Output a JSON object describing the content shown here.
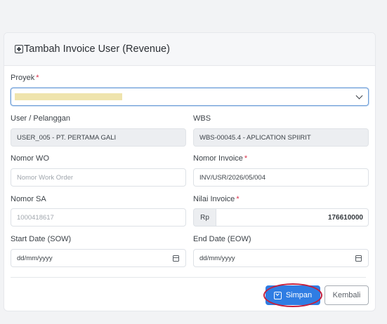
{
  "form": {
    "title": "Tambah Invoice User (Revenue)",
    "proyek_label": "Proyek",
    "required_mark": "*",
    "user_label": "User / Pelanggan",
    "user_value": "USER_005 - PT. PERTAMA GALI",
    "wbs_label": "WBS",
    "wbs_value": "WBS-00045.4 - APLICATION SPIIRIT",
    "wo_label": "Nomor WO",
    "wo_placeholder": "Nomor Work Order",
    "invoice_no_label": "Nomor Invoice",
    "invoice_no_value": "INV/USR/2026/05/004",
    "sa_label": "Nomor SA",
    "sa_value": "1000418617",
    "nilai_label": "Nilai Invoice",
    "currency": "Rp",
    "nilai_value": "176610000",
    "start_label": "Start Date (SOW)",
    "start_placeholder": "dd/mm/yyyy",
    "end_label": "End Date (EOW)",
    "end_placeholder": "dd/mm/yyyy",
    "save_label": "Simpan",
    "back_label": "Kembali"
  },
  "colors": {
    "primary": "#2f7de3",
    "highlight_ring": "#c41f3c",
    "redaction": "#efe4ad"
  }
}
